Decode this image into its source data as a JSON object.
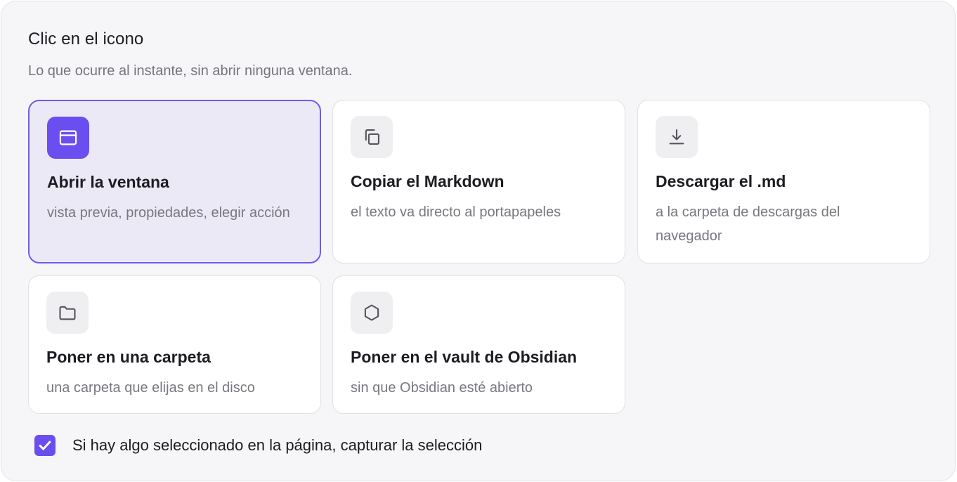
{
  "header": {
    "title": "Clic en el icono",
    "subtitle": "Lo que ocurre al instante, sin abrir ninguna ventana."
  },
  "options": [
    {
      "icon": "window-icon",
      "title": "Abrir la ventana",
      "desc": "vista previa, propiedades, elegir acción",
      "selected": true
    },
    {
      "icon": "copy-icon",
      "title": "Copiar el Markdown",
      "desc": "el texto va directo al portapapeles",
      "selected": false
    },
    {
      "icon": "download-icon",
      "title": "Descargar el .md",
      "desc": "a la carpeta de descargas del navegador",
      "selected": false
    },
    {
      "icon": "folder-icon",
      "title": "Poner en una carpeta",
      "desc": "una carpeta que elijas en el disco",
      "selected": false
    },
    {
      "icon": "obsidian-icon",
      "title": "Poner en el vault de Obsidian",
      "desc": "sin que Obsidian esté abierto",
      "selected": false
    }
  ],
  "selection_option": {
    "label": "Si hay algo seleccionado en la página, capturar la selección",
    "checked": true
  },
  "colors": {
    "accent": "#6a4ef0",
    "selected_bg": "#ece9f7",
    "panel_bg": "#f6f6f8"
  }
}
